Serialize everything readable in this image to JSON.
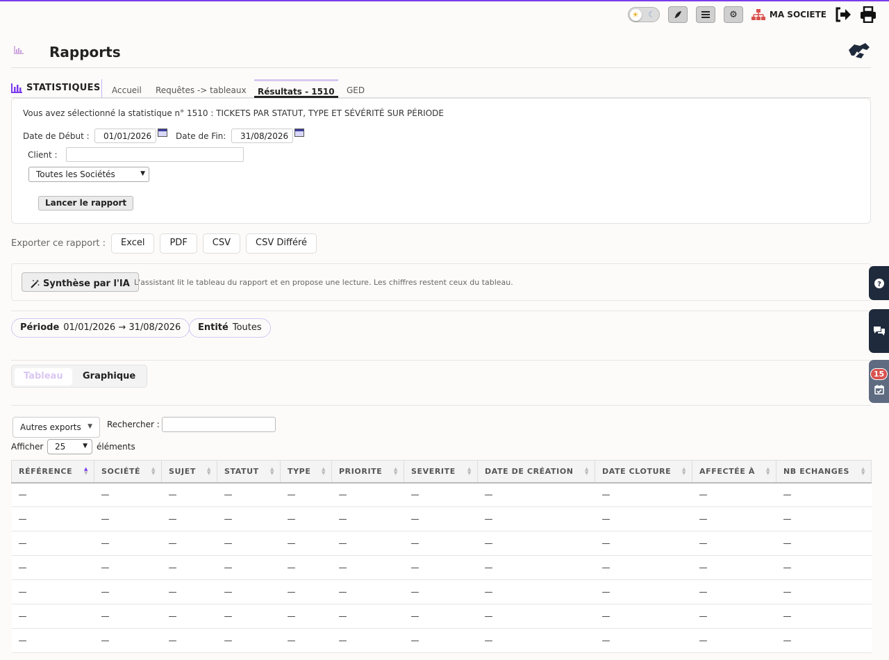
{
  "topbar": {
    "company": "MA SOCIETE",
    "icons": [
      "sun-icon",
      "moon-icon",
      "feather-icon",
      "menu-icon",
      "gear-icon",
      "sitemap-icon",
      "logout-icon",
      "print-icon"
    ]
  },
  "header": {
    "title": "Rapports"
  },
  "tabs": {
    "section_label": "STATISTIQUES",
    "items": [
      {
        "label": "Accueil"
      },
      {
        "label": "Requêtes -> tableaux"
      },
      {
        "label": "Résultats - 1510",
        "active": true
      },
      {
        "label": "GED"
      }
    ]
  },
  "criteria": {
    "description": "Vous avez sélectionné la statistique n° 1510 : TICKETS PAR STATUT, TYPE ET SÉVÉRITÉ SUR PÉRIODE",
    "start_label": "Date de Début :",
    "start_value": "01/01/2026",
    "end_label": "Date de Fin:",
    "end_value": "31/08/2026",
    "client_label": "Client :",
    "client_value": "",
    "company_select": "Toutes les Sociétés",
    "launch_label": "Lancer le rapport"
  },
  "export": {
    "label": "Exporter ce rapport :",
    "buttons": [
      "Excel",
      "PDF",
      "CSV",
      "CSV Différé"
    ]
  },
  "ai": {
    "button_label": "Synthèse par l'IA",
    "description": "L'assistant lit le tableau du rapport et en propose une lecture. Les chiffres restent ceux du tableau."
  },
  "chips": {
    "period_label": "Période",
    "period_value": "01/01/2026 → 31/08/2026",
    "entity_label": "Entité",
    "entity_value": "Toutes"
  },
  "view": {
    "table_label": "Tableau",
    "chart_label": "Graphique"
  },
  "datatable": {
    "other_exports": "Autres exports",
    "search_label": "Rechercher :",
    "search_value": "",
    "show_label": "Afficher",
    "show_value": "25",
    "show_after": "éléments",
    "columns": [
      "RÉFÉRENCE",
      "SOCIÉTÉ",
      "SUJET",
      "STATUT",
      "TYPE",
      "PRIORITE",
      "SEVERITE",
      "DATE DE CRÉATION",
      "DATE CLOTURE",
      "AFFECTÉE À",
      "NB ECHANGES"
    ],
    "rows": [
      [
        "—",
        "—",
        "—",
        "—",
        "—",
        "—",
        "—",
        "—",
        "—",
        "—",
        "—"
      ],
      [
        "—",
        "—",
        "—",
        "—",
        "—",
        "—",
        "—",
        "—",
        "—",
        "—",
        "—"
      ],
      [
        "—",
        "—",
        "—",
        "—",
        "—",
        "—",
        "—",
        "—",
        "—",
        "—",
        "—"
      ],
      [
        "—",
        "—",
        "—",
        "—",
        "—",
        "—",
        "—",
        "—",
        "—",
        "—",
        "—"
      ],
      [
        "—",
        "—",
        "—",
        "—",
        "—",
        "—",
        "—",
        "—",
        "—",
        "—",
        "—"
      ],
      [
        "—",
        "—",
        "—",
        "—",
        "—",
        "—",
        "—",
        "—",
        "—",
        "—",
        "—"
      ],
      [
        "—",
        "—",
        "—",
        "—",
        "—",
        "—",
        "—",
        "—",
        "—",
        "—",
        "—"
      ]
    ]
  },
  "side": {
    "agenda_badge": "15"
  },
  "colors": {
    "accent": "#7c3aed",
    "dark": "#1f2a3c",
    "badge": "#d9534f"
  }
}
